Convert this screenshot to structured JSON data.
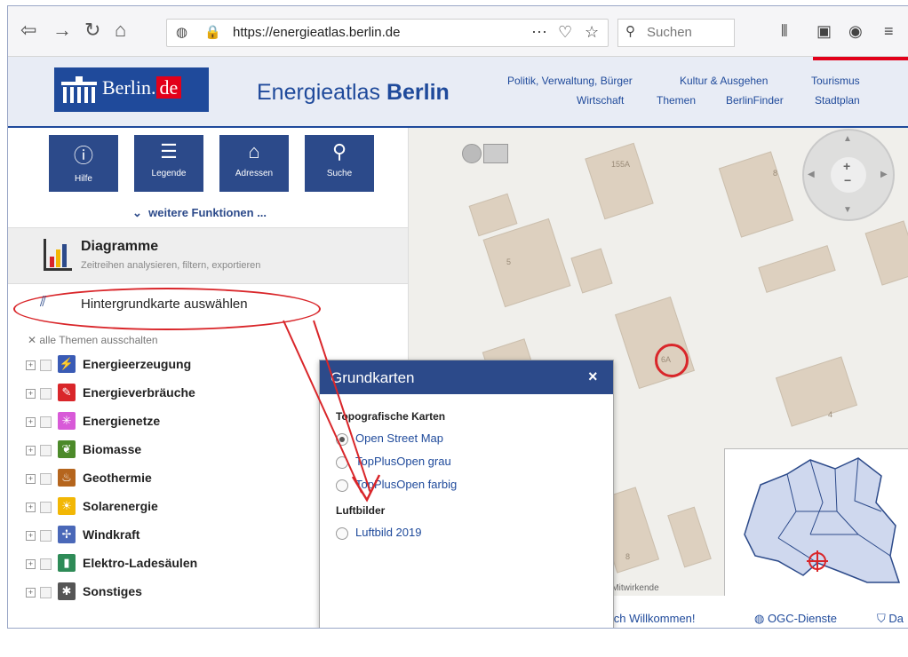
{
  "browser": {
    "url": "https://energieatlas.berlin.de",
    "search_placeholder": "Suchen"
  },
  "header": {
    "logo_text": "Berlin.",
    "logo_de": "de",
    "title_plain": "Energieatlas ",
    "title_bold": "Berlin",
    "menu_row1": [
      "Politik, Verwaltung, Bürger",
      "Kultur & Ausgehen",
      "Tourismus"
    ],
    "menu_row2": [
      "Wirtschaft",
      "Themen",
      "BerlinFinder",
      "Stadtplan"
    ]
  },
  "panel": {
    "buttons": [
      {
        "label": "Hilfe",
        "icon": "?"
      },
      {
        "label": "Legende",
        "icon": "list"
      },
      {
        "label": "Adressen",
        "icon": "house-search"
      },
      {
        "label": "Suche",
        "icon": "magnifier"
      }
    ],
    "more_label": "weitere Funktionen ...",
    "diagramme_title": "Diagramme",
    "diagramme_sub": "Zeitreihen analysieren, filtern, exportieren",
    "bgmap_label": "Hintergrundkarte auswählen",
    "all_off": "alle Themen ausschalten",
    "themes": [
      {
        "label": "Energieerzeugung",
        "color": "#3a5bb5",
        "glyph": "⚡"
      },
      {
        "label": "Energieverbräuche",
        "color": "#d9262a",
        "glyph": "🔌"
      },
      {
        "label": "Energienetze",
        "color": "#d85ad8",
        "glyph": "✳"
      },
      {
        "label": "Biomasse",
        "color": "#4c8a2a",
        "glyph": "❦"
      },
      {
        "label": "Geothermie",
        "color": "#b5651d",
        "glyph": "♨"
      },
      {
        "label": "Solarenergie",
        "color": "#f2b705",
        "glyph": "☀"
      },
      {
        "label": "Windkraft",
        "color": "#4a68b8",
        "glyph": "✢"
      },
      {
        "label": "Elektro-Ladesäulen",
        "color": "#2e8b57",
        "glyph": "▮"
      },
      {
        "label": "Sonstiges",
        "color": "#555555",
        "glyph": "✱"
      }
    ]
  },
  "map": {
    "building_labels": [
      "155A",
      "5",
      "6A",
      "4",
      "8",
      "8"
    ],
    "attribution": "-Mitwirkende"
  },
  "popup": {
    "title": "Grundkarten",
    "close": "×",
    "group1": "Topografische Karten",
    "options1": [
      {
        "label": "Open Street Map",
        "selected": true
      },
      {
        "label": "TopPlusOpen grau",
        "selected": false
      },
      {
        "label": "TopPlusOpen farbig",
        "selected": false
      }
    ],
    "group2": "Luftbilder",
    "options2": [
      {
        "label": "Luftbild 2019",
        "selected": false
      }
    ]
  },
  "bottombar": {
    "welcome": "lich Willkommen!",
    "ogc": "OGC-Dienste",
    "da": "Da"
  }
}
